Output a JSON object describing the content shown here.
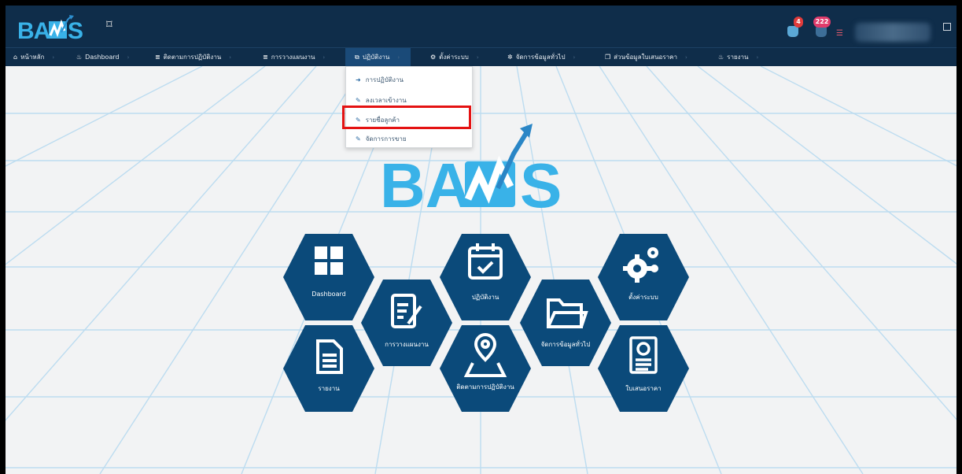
{
  "header": {
    "logo": "BAMS",
    "notifications": [
      {
        "icon": "bell-icon",
        "count": "4",
        "color": "#e03b3b"
      },
      {
        "icon": "chat-icon",
        "count": "222",
        "color": "#e03b6b"
      }
    ],
    "menu_icon": "hamburger-icon"
  },
  "nav": {
    "items": [
      {
        "label": "หน้าหลัก",
        "icon": "home-icon"
      },
      {
        "label": "Dashboard",
        "icon": "fire-icon"
      },
      {
        "label": "ติดตามการปฏิบัติงาน",
        "icon": "list-icon"
      },
      {
        "label": "การวางแผนงาน",
        "icon": "list-icon"
      },
      {
        "label": "ปฏิบัติงาน",
        "icon": "external-link-icon"
      },
      {
        "label": "ตั้งค่าระบบ",
        "icon": "gears-icon"
      },
      {
        "label": "จัดการข้อมูลทั่วไป",
        "icon": "gear-icon"
      },
      {
        "label": "ส่วนข้อมูลใบเสนอราคา",
        "icon": "copy-icon"
      },
      {
        "label": "รายงาน",
        "icon": "fire-icon"
      }
    ]
  },
  "dropdown": {
    "items": [
      {
        "label": "การปฏิบัติงาน",
        "icon": "sign-in-icon"
      },
      {
        "label": "ลงเวลาเข้างาน",
        "icon": "pencil-icon"
      },
      {
        "label": "รายชื่อลูกค้า",
        "icon": "pencil-icon"
      },
      {
        "label": "จัดการการขาย",
        "icon": "pencil-icon"
      }
    ]
  },
  "center_logo": "BAMS",
  "tiles": [
    {
      "label": "Dashboard",
      "icon": "grid-icon"
    },
    {
      "label": "การวางแผนงาน",
      "icon": "clipboard-edit-icon"
    },
    {
      "label": "ปฏิบัติงาน",
      "icon": "calendar-check-icon"
    },
    {
      "label": "จัดการข้อมูลทั่วไป",
      "icon": "folder-icon"
    },
    {
      "label": "ตั้งค่าระบบ",
      "icon": "gears-icon"
    },
    {
      "label": "รายงาน",
      "icon": "document-icon"
    },
    {
      "label": "ติดตามการปฏิบัติงาน",
      "icon": "map-pin-icon"
    },
    {
      "label": "ใบเสนอราคา",
      "icon": "invoice-icon"
    }
  ],
  "colors": {
    "header_bg": "#0f2d4a",
    "hex_bg": "#0b4a7a",
    "accent": "#39b2e8",
    "highlight": "#e41212"
  }
}
